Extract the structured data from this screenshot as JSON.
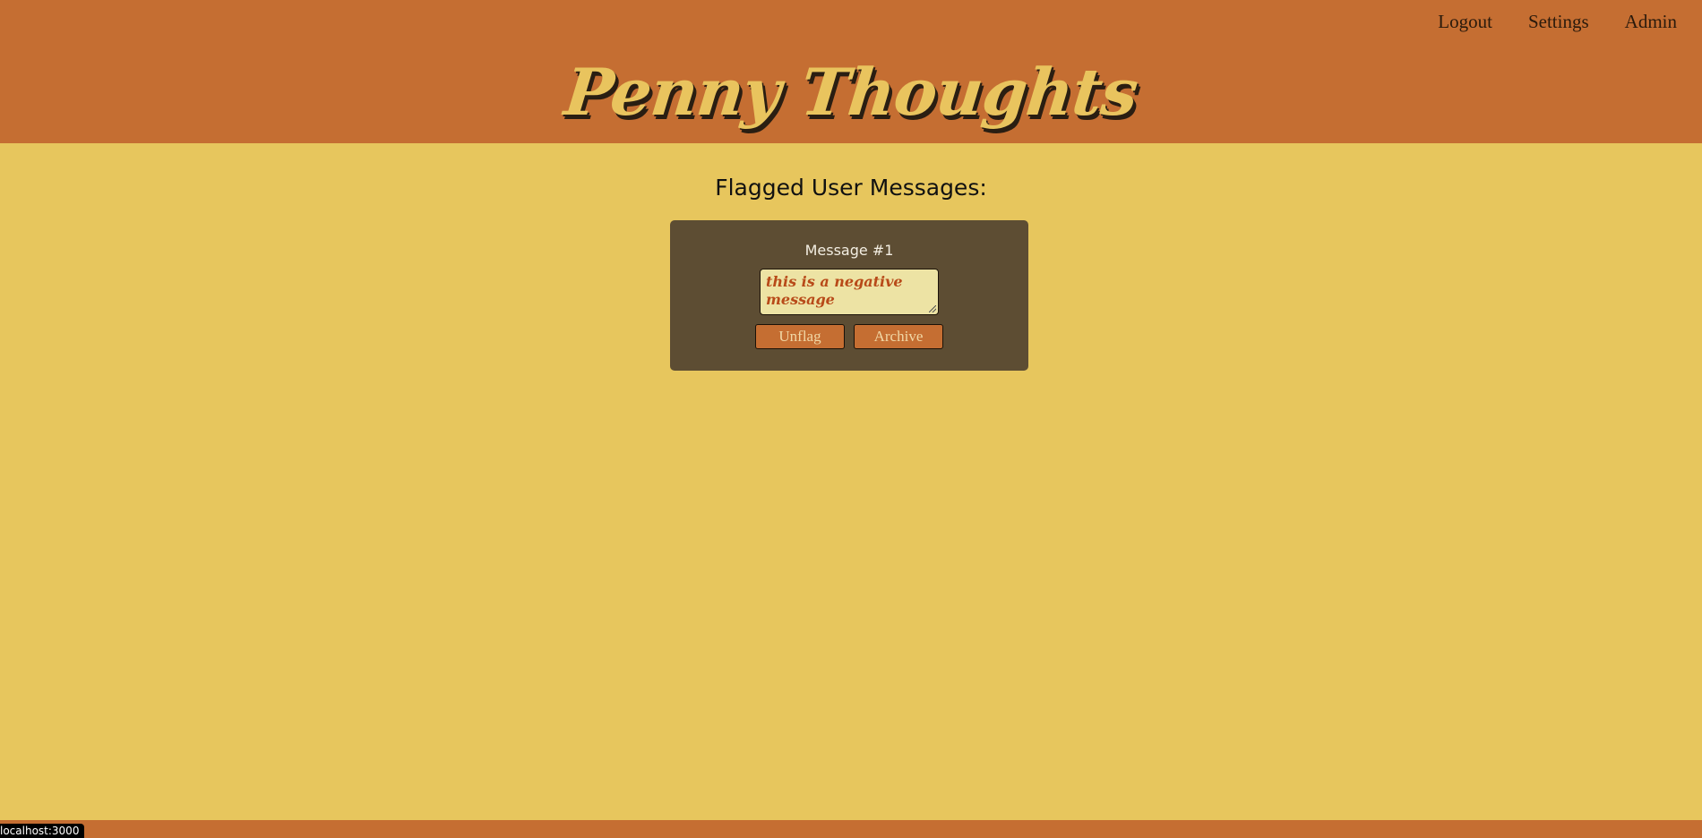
{
  "nav": {
    "items": [
      {
        "label": "Logout"
      },
      {
        "label": "Settings"
      },
      {
        "label": "Admin"
      }
    ]
  },
  "brand": {
    "logo_text": "Penny Thoughts"
  },
  "main": {
    "title": "Flagged User Messages:",
    "messages": [
      {
        "heading": "Message #1",
        "text": "this is a negative message",
        "unflag_label": "Unflag",
        "archive_label": "Archive"
      }
    ]
  },
  "status_bar": {
    "url": "localhost:3000"
  },
  "colors": {
    "header_bg": "#c56e32",
    "page_bg": "#e7c65d",
    "card_bg": "#5d4d33",
    "message_bg": "#ede3a4",
    "message_text": "#b84a19"
  }
}
